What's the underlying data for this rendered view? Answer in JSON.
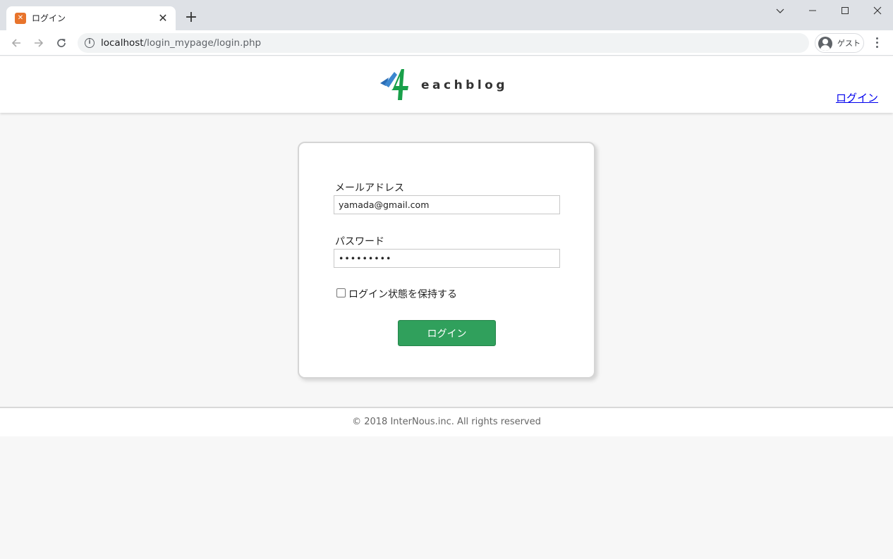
{
  "browser": {
    "tab_title": "ログイン",
    "url_host": "localhost",
    "url_path": "/login_mypage/login.php",
    "profile_label": "ゲスト"
  },
  "header": {
    "logo_text": "eachblog",
    "login_link": "ログイン"
  },
  "form": {
    "email_label": "メールアドレス",
    "email_value": "yamada@gmail.com",
    "password_label": "パスワード",
    "password_value": "•••••••••",
    "remember_label": "ログイン状態を保持する",
    "submit_label": "ログイン"
  },
  "footer": {
    "text": "© 2018 InterNous.inc. All rights reserved"
  },
  "colors": {
    "submit_button": "#30a05c",
    "tab_favicon": "#e8742c",
    "link": "#0000ee"
  }
}
